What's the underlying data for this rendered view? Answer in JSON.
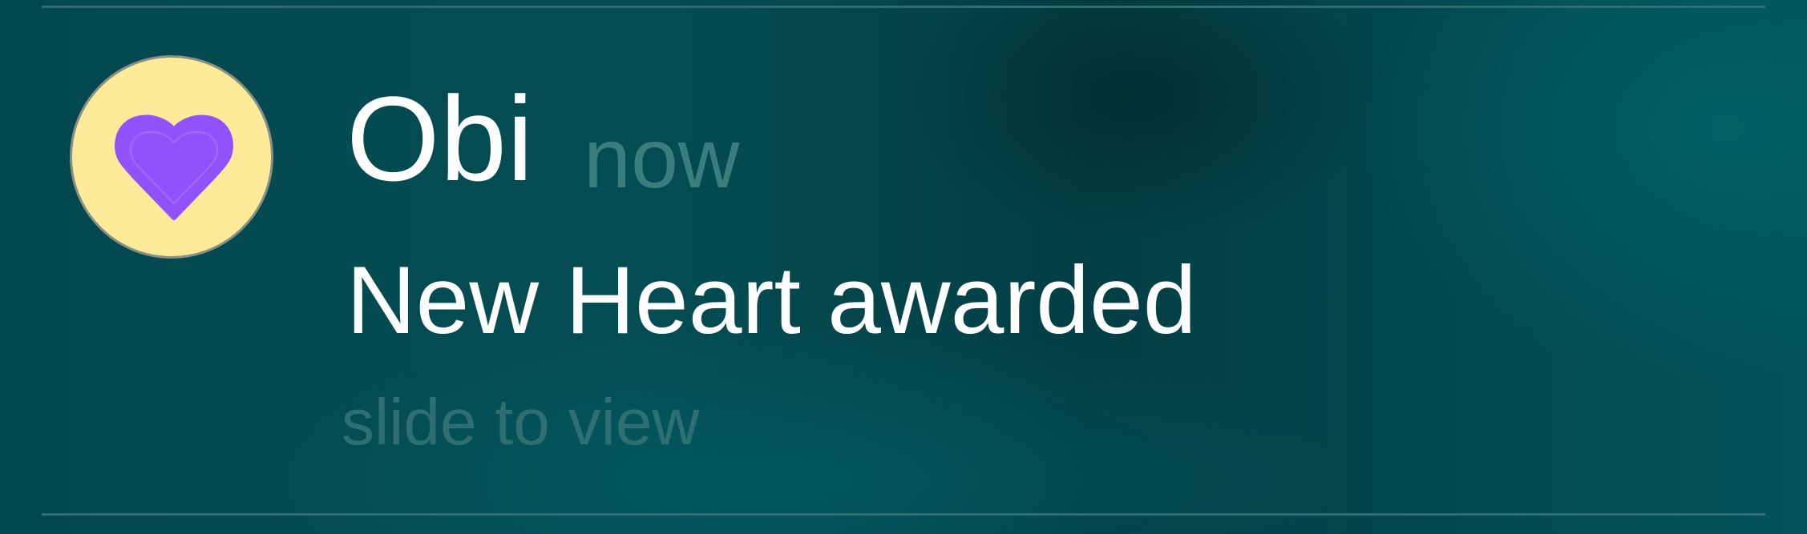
{
  "notification": {
    "sender": "Obi",
    "time": "now",
    "message": "New Heart awarded",
    "hint": "slide to view"
  },
  "avatar": {
    "icon": "heart-icon",
    "background_color": "#fdeb9a",
    "icon_color": "#9152fb"
  },
  "colors": {
    "background": "#03484e",
    "primary_text": "#ffffff",
    "secondary_text": "#3b7c7d"
  }
}
